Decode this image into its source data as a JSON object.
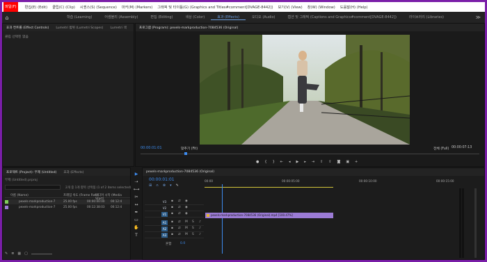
{
  "menu": [
    "파일(F)",
    "편집(E) (Edit)",
    "클립(C) (Clip)",
    "시퀀스(S) (Sequence)",
    "마커(M) (Markers)",
    "그래픽 및 타이틀(G) (Graphics and Titles#comment[DVAGE-8442])",
    "보기(V) (View)",
    "창(W) (Window)",
    "도움말(H) (Help)"
  ],
  "workspaces": [
    "학습 (Learning)",
    "어셈블리 (Assembly)",
    "편집 (Editing)",
    "색상 (Color)",
    "효과 (Effects)",
    "오디오 (Audio)",
    "캡션 및 그래픽 (Captions and Graphics#comment[DVAGE-8442])",
    "라이브러리 (Libraries)"
  ],
  "effect_controls": {
    "tabs": [
      "효과 컨트롤 (Effect Controls)",
      "Lumetri 범위 (Lumetri Scopes)",
      "Lumetri 색"
    ],
    "empty_text": "클립 선택된 없음"
  },
  "program": {
    "title": "프로그램 (Program): pexels-markproduction-7084536 (Original)",
    "timecode": "00:00:01:01",
    "fit": "맞추기 (Fit)",
    "quality": "전체 (Full)",
    "duration": "00:00:07:13"
  },
  "project": {
    "tabs": [
      "프로젝트 (Project): 무제 (Untitled)",
      "효과 (Effects)"
    ],
    "file": "무제 (Untitled).prproj",
    "selection_info": "2개 중 1개 항목 선택됨 (1 of 2 items selected)",
    "headers": [
      "이름 (Name)",
      "프레임 속도 (Frame Rate)",
      "미디어 시작 (Media Start)"
    ],
    "rows": [
      {
        "name": "pexels-markproduction-7",
        "fps": "25.00 fps",
        "start": "00:00:00:00",
        "end": "00:12:4"
      },
      {
        "name": "pexels-markproduction-7",
        "fps": "25.00 fps",
        "start": "00:12:38:03",
        "end": "00:12:4"
      }
    ]
  },
  "timeline": {
    "title": "pexels-markproduction-7084536 (Original)",
    "timecode": "00:00:01:01",
    "ruler": [
      "00:00",
      "00:00:05:00",
      "00:00:10:00",
      "00:00:15:00"
    ],
    "video_tracks": [
      "V3",
      "V2",
      "V1"
    ],
    "audio_tracks": [
      "A1",
      "A2",
      "A3"
    ],
    "master": "혼합",
    "master_value": "0.0",
    "clip_label": "pexels-markproduction-7084536 (Original).mp4 [100.47%]"
  }
}
